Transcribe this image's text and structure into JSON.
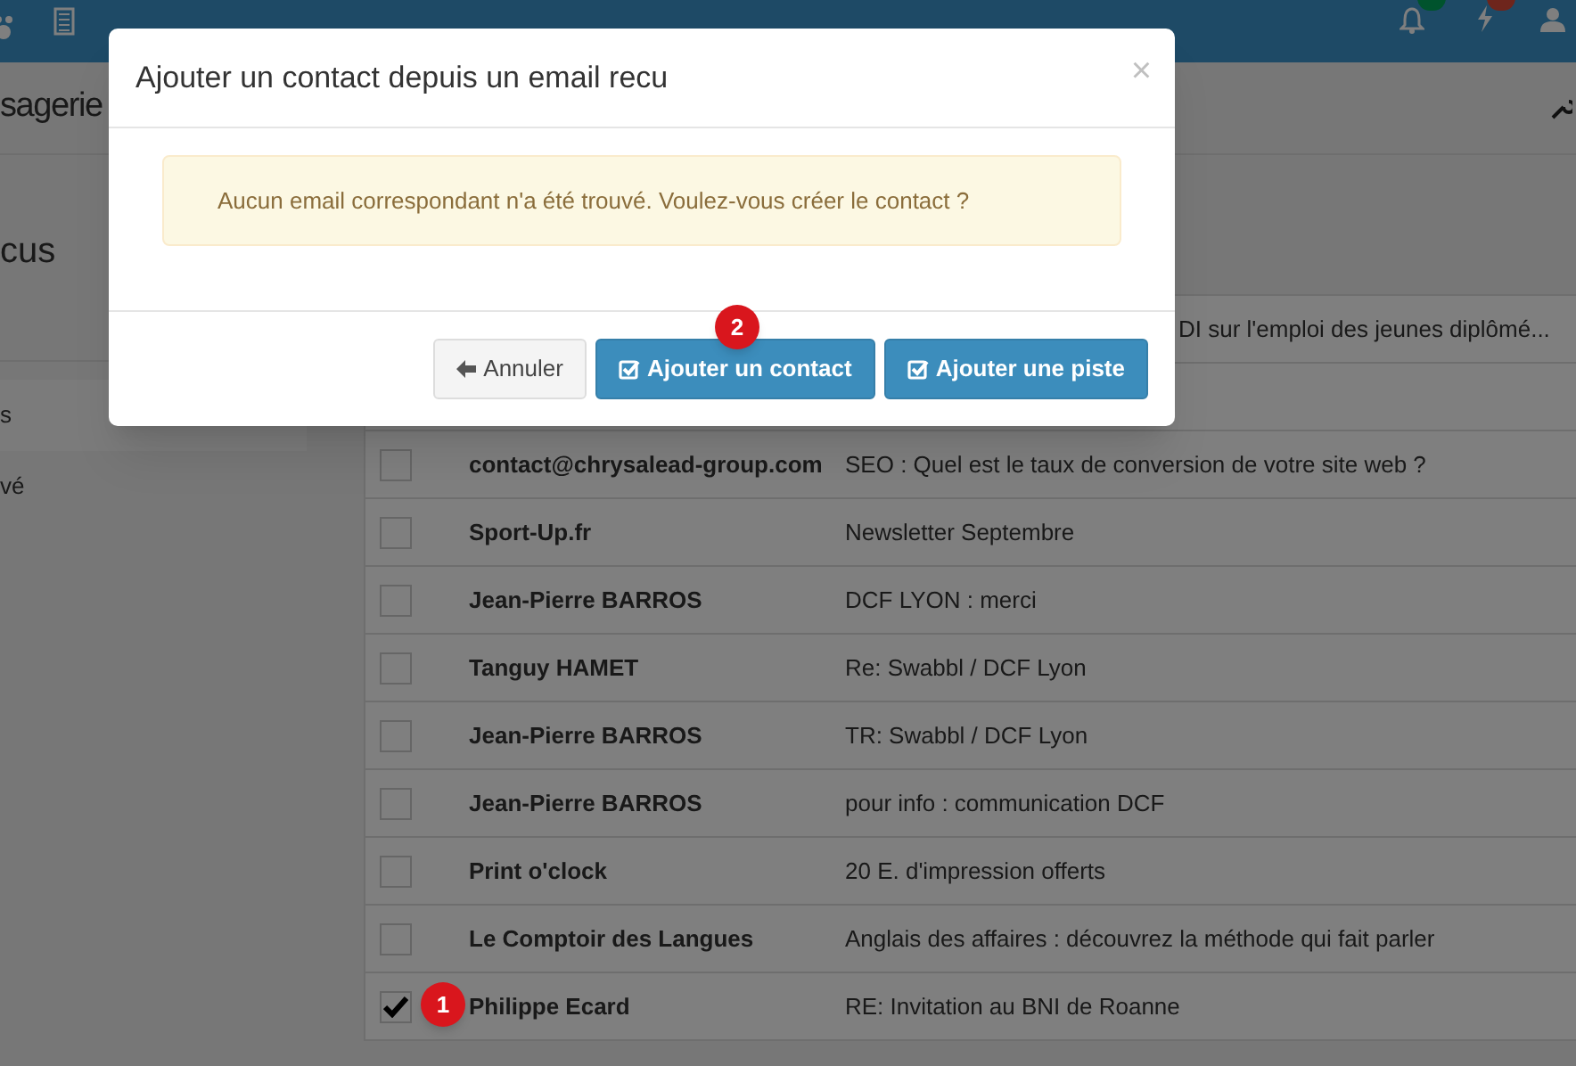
{
  "page": {
    "title": "sagerie",
    "subtitle": "cus"
  },
  "sidebar": {
    "items": [
      {
        "label": "s",
        "selected": true
      },
      {
        "label": "vé",
        "selected": false
      }
    ]
  },
  "table": {
    "partial_subject": "DI sur l'emploi des jeunes diplômé...",
    "rows": [
      {
        "sender": "contact@chrysalead-group.com",
        "subject": "SEO : Quel est le taux de conversion de votre site web ?",
        "checked": false
      },
      {
        "sender": "Sport-Up.fr",
        "subject": "Newsletter Septembre",
        "checked": false
      },
      {
        "sender": "Jean-Pierre BARROS",
        "subject": "DCF LYON : merci",
        "checked": false
      },
      {
        "sender": "Tanguy HAMET",
        "subject": "Re: Swabbl / DCF Lyon",
        "checked": false
      },
      {
        "sender": "Jean-Pierre BARROS",
        "subject": "TR: Swabbl / DCF Lyon",
        "checked": false
      },
      {
        "sender": "Jean-Pierre BARROS",
        "subject": "pour info : communication DCF",
        "checked": false
      },
      {
        "sender": "Print o'clock",
        "subject": "20 E. d'impression offerts",
        "checked": false
      },
      {
        "sender": "Le Comptoir des Langues",
        "subject": "Anglais des affaires : découvrez la méthode qui fait parler",
        "checked": false
      },
      {
        "sender": "Philippe Ecard",
        "subject": "RE: Invitation au BNI de Roanne",
        "checked": true
      }
    ]
  },
  "modal": {
    "title": "Ajouter un contact depuis un email recu",
    "close": "×",
    "alert": "Aucun email correspondant n'a été trouvé. Voulez-vous créer le contact ?",
    "buttons": [
      {
        "label": "Annuler",
        "kind": "default"
      },
      {
        "label": "Ajouter un contact",
        "kind": "primary"
      },
      {
        "label": "Ajouter une piste",
        "kind": "primary"
      }
    ]
  },
  "annotations": [
    {
      "number": "1"
    },
    {
      "number": "2"
    }
  ]
}
